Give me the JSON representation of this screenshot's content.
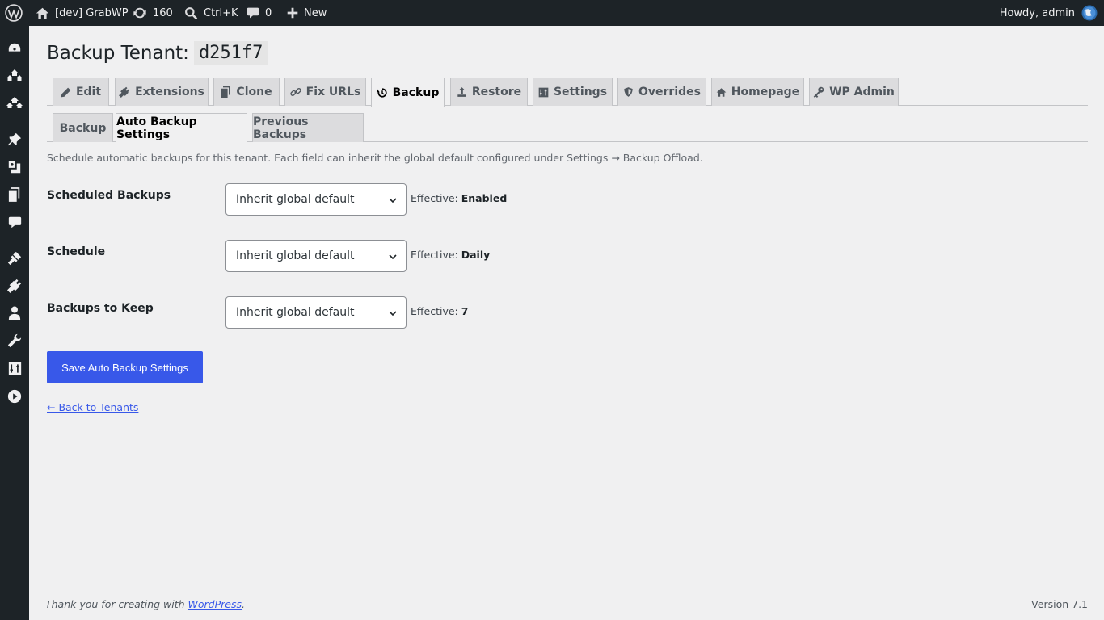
{
  "adminbar": {
    "site_name": "[dev] GrabWP",
    "updates_count": "160",
    "search_shortcut": "Ctrl+K",
    "comments_count": "0",
    "new_label": "New",
    "howdy": "Howdy, admin"
  },
  "menu_icons": [
    "dashboard-icon",
    "network-icon",
    "network-alt-icon",
    "pin-icon",
    "media-icon",
    "pages-icon",
    "comments-icon",
    "appearance-icon",
    "plugins-icon",
    "users-icon",
    "tools-icon",
    "settings-icon",
    "play-icon"
  ],
  "page": {
    "title_prefix": "Backup Tenant:",
    "tenant_id": "d251f7"
  },
  "tabs": [
    {
      "label": "Edit",
      "icon": "pencil-icon"
    },
    {
      "label": "Extensions",
      "icon": "plug-icon"
    },
    {
      "label": "Clone",
      "icon": "copy-icon"
    },
    {
      "label": "Fix URLs",
      "icon": "link-icon"
    },
    {
      "label": "Backup",
      "icon": "history-icon",
      "active": true
    },
    {
      "label": "Restore",
      "icon": "upload-icon"
    },
    {
      "label": "Settings",
      "icon": "settings-icon"
    },
    {
      "label": "Overrides",
      "icon": "shield-icon"
    },
    {
      "label": "Homepage",
      "icon": "home-icon"
    },
    {
      "label": "WP Admin",
      "icon": "key-icon"
    }
  ],
  "subtabs": [
    {
      "label": "Backup"
    },
    {
      "label": "Auto Backup Settings",
      "active": true
    },
    {
      "label": "Previous Backups"
    }
  ],
  "description": "Schedule automatic backups for this tenant. Each field can inherit the global default configured under Settings → Backup Offload.",
  "fields": [
    {
      "label": "Scheduled Backups",
      "value": "Inherit global default",
      "effective_label": "Effective:",
      "effective_value": "Enabled"
    },
    {
      "label": "Schedule",
      "value": "Inherit global default",
      "effective_label": "Effective:",
      "effective_value": "Daily"
    },
    {
      "label": "Backups to Keep",
      "value": "Inherit global default",
      "effective_label": "Effective:",
      "effective_value": "7"
    }
  ],
  "save_button": "Save Auto Backup Settings",
  "back_link": "← Back to Tenants",
  "footer": {
    "thanks_prefix": "Thank you for creating with",
    "thanks_link": "WordPress",
    "thanks_suffix": ".",
    "version": "Version 7.1"
  },
  "colors": {
    "adminbar_bg": "#1d2327",
    "accent": "#3858e9",
    "page_bg": "#f0f0f1"
  }
}
